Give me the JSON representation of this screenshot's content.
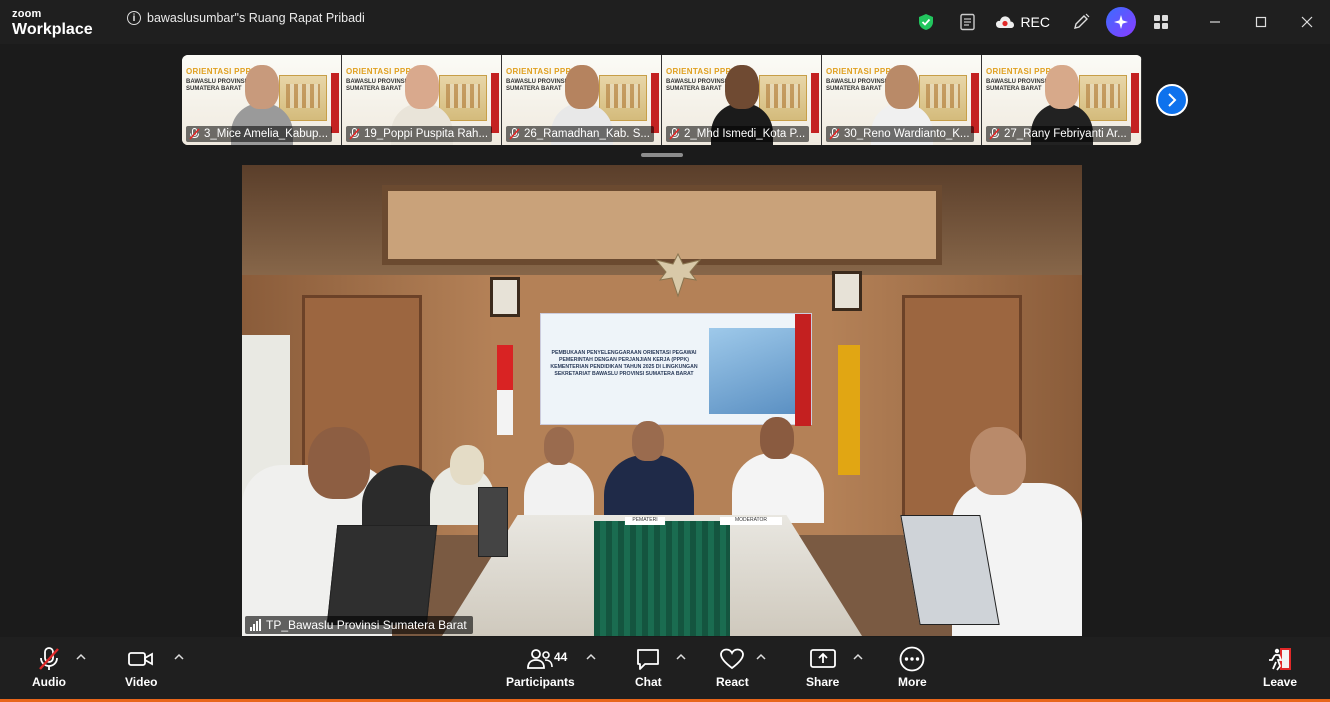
{
  "window": {
    "brand_top": "zoom",
    "brand_bottom": "Workplace",
    "meeting_title": "bawaslusumbar\"s Ruang Rapat Pribadi",
    "rec_label": "REC",
    "icons": [
      "shield-check-icon",
      "notes-icon",
      "cloud-record-icon",
      "pen-icon",
      "ai-companion-icon",
      "apps-icon",
      "minimize-icon",
      "maximize-icon",
      "close-icon"
    ]
  },
  "gallery": {
    "tiles": [
      {
        "label": "3_Mice Amelia_Kabup...",
        "skin": "#c89a7c",
        "shirt": "#9a9a9a"
      },
      {
        "label": "19_Poppi Puspita Rah...",
        "skin": "#d9a98d",
        "shirt": "#e9e4d9"
      },
      {
        "label": "26_Ramadhan_Kab. S...",
        "skin": "#b5835f",
        "shirt": "#e8e8e8"
      },
      {
        "label": "2_Mhd Ismedi_Kota P...",
        "skin": "#6f4a32",
        "shirt": "#1b1b1b"
      },
      {
        "label": "30_Reno Wardianto_K...",
        "skin": "#b98a68",
        "shirt": "#f0f0f0"
      },
      {
        "label": "27_Rany Febriyanti Ar...",
        "skin": "#d7a98a",
        "shirt": "#222222"
      }
    ],
    "banner_title": "ORIENTASI PPPK",
    "banner_subtitle_1": "BAWASLU PROVINSI",
    "banner_subtitle_2": "SUMATERA BARAT"
  },
  "main_video": {
    "speaker_label": "TP_Bawaslu Provinsi Sumatera Barat",
    "screen_text": "PEMBUKAAN PENYELENGGARAAN ORIENTASI PEGAWAI PEMERINTAH DENGAN PERJANJIAN KERJA (PPPK) KEMENTERIAN PENDIDIKAN TAHUN 2025 DI LINGKUNGAN SEKRETARIAT BAWASLU PROVINSI SUMATERA BARAT",
    "name_plates": [
      "PEMATERI",
      "MODERATOR"
    ]
  },
  "toolbar": {
    "audio": "Audio",
    "video": "Video",
    "participants": "Participants",
    "participant_count": "44",
    "chat": "Chat",
    "react": "React",
    "share": "Share",
    "more": "More",
    "leave": "Leave"
  },
  "colors": {
    "accent_blue": "#0e72ed",
    "muted_red": "#e02828",
    "leave_red": "#e02828",
    "shield_green": "#22c55e"
  }
}
